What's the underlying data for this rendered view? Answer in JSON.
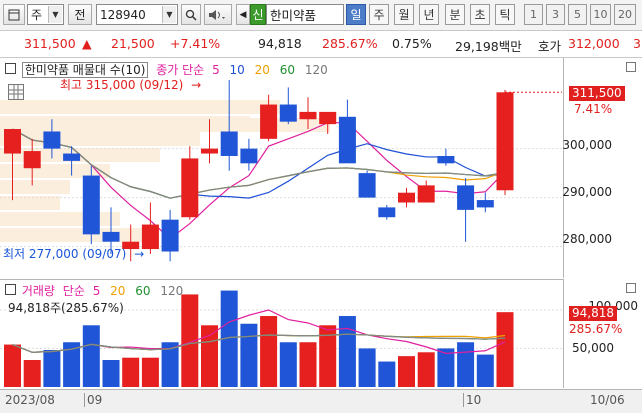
{
  "toolbar": {
    "market": "주",
    "jeon_label": "전",
    "stock_code": "128940",
    "search_icon": "search-icon",
    "company_badge": "신",
    "company_name": "한미약품",
    "periods": [
      "일",
      "주",
      "월",
      "년",
      "분",
      "초",
      "틱"
    ],
    "active_period": "일",
    "numbers": [
      "1",
      "3",
      "5",
      "10",
      "20"
    ]
  },
  "quote": {
    "price": "311,500",
    "change_arrow": "▲",
    "change": "21,500",
    "change_pct": "+7.41%",
    "volume": "94,818",
    "volume_ratio": "285.67%",
    "turnover": "0.75%",
    "amount": "29,198백만",
    "hoga_label": "호가",
    "hoga_value": "312,000",
    "hoga_trailing": "3"
  },
  "price_panel": {
    "title": "한미약품 매물대 수(10)",
    "legend_ma": "종가 단순",
    "ma_periods": [
      "5",
      "10",
      "20",
      "60",
      "120"
    ],
    "ma_colors": [
      "#e0209f",
      "#1f4fd6",
      "#f0a000",
      "#1f8f2f",
      "#777777"
    ],
    "high_annot": "최고 315,000 (09/12)",
    "low_annot": "최저 277,000 (09/07)",
    "axis_ticks": [
      "300,000",
      "290,000",
      "280,000"
    ],
    "price_tag": "311,500",
    "pct_tag": "7.41%"
  },
  "volume_panel": {
    "legend_title": "거래량",
    "legend_ma": "단순",
    "ma_periods": [
      "5",
      "20",
      "60",
      "120"
    ],
    "ma_colors": [
      "#e0209f",
      "#f0a000",
      "#1f8f2f",
      "#777777"
    ],
    "volume_text": "94,818주(285.67%)",
    "axis_ticks": [
      "100,000",
      "50,000"
    ],
    "vol_tag": "94,818",
    "pct_tag": "285.67%"
  },
  "dates": {
    "left": "2023/08",
    "d1": "09",
    "d2": "10",
    "right": "10/06"
  },
  "chart_data": {
    "type": "candlestick",
    "title": "한미약품 매물대 수(10)",
    "ylim": [
      274000,
      318500
    ],
    "candles": [
      {
        "o": 299000,
        "h": 301500,
        "l": 289500,
        "c": 304000
      },
      {
        "o": 296000,
        "h": 302000,
        "l": 292500,
        "c": 299500
      },
      {
        "o": 303500,
        "h": 306000,
        "l": 298000,
        "c": 300000
      },
      {
        "o": 299000,
        "h": 300500,
        "l": 294500,
        "c": 297500
      },
      {
        "o": 294500,
        "h": 296500,
        "l": 280500,
        "c": 282500
      },
      {
        "o": 283000,
        "h": 288000,
        "l": 278500,
        "c": 281000
      },
      {
        "o": 279500,
        "h": 284500,
        "l": 277000,
        "c": 281000
      },
      {
        "o": 279500,
        "h": 289000,
        "l": 278500,
        "c": 284500
      },
      {
        "o": 285500,
        "h": 287500,
        "l": 277000,
        "c": 279000
      },
      {
        "o": 286000,
        "h": 300500,
        "l": 285500,
        "c": 298000
      },
      {
        "o": 299000,
        "h": 306000,
        "l": 297000,
        "c": 300000
      },
      {
        "o": 303500,
        "h": 314000,
        "l": 295500,
        "c": 298500
      },
      {
        "o": 300000,
        "h": 302000,
        "l": 295500,
        "c": 297000
      },
      {
        "o": 302000,
        "h": 311000,
        "l": 301500,
        "c": 309000
      },
      {
        "o": 309000,
        "h": 312500,
        "l": 305000,
        "c": 305500
      },
      {
        "o": 306000,
        "h": 310500,
        "l": 304000,
        "c": 307500
      },
      {
        "o": 305000,
        "h": 306000,
        "l": 303000,
        "c": 307500
      },
      {
        "o": 306500,
        "h": 310000,
        "l": 298000,
        "c": 297000
      },
      {
        "o": 295000,
        "h": 295500,
        "l": 290500,
        "c": 290000
      },
      {
        "o": 288000,
        "h": 288500,
        "l": 285500,
        "c": 286000
      },
      {
        "o": 289000,
        "h": 292000,
        "l": 288000,
        "c": 291000
      },
      {
        "o": 289000,
        "h": 293500,
        "l": 289000,
        "c": 292500
      },
      {
        "o": 298500,
        "h": 300000,
        "l": 296500,
        "c": 297000
      },
      {
        "o": 292500,
        "h": 294000,
        "l": 281000,
        "c": 287500
      },
      {
        "o": 289500,
        "h": 291000,
        "l": 287000,
        "c": 288000
      },
      {
        "o": 291500,
        "h": 312000,
        "l": 290500,
        "c": 311500
      }
    ],
    "volumes": [
      55000,
      35000,
      48000,
      58000,
      80000,
      35000,
      38000,
      38000,
      58000,
      120000,
      80000,
      125000,
      82000,
      92000,
      58000,
      58000,
      80000,
      92000,
      50000,
      33000,
      40000,
      45000,
      50000,
      58000,
      42000,
      97000
    ],
    "volume_ylim": [
      0,
      140000
    ],
    "volume_ticks": [
      50000,
      100000
    ],
    "price_ticks": [
      280000,
      290000,
      300000
    ]
  }
}
